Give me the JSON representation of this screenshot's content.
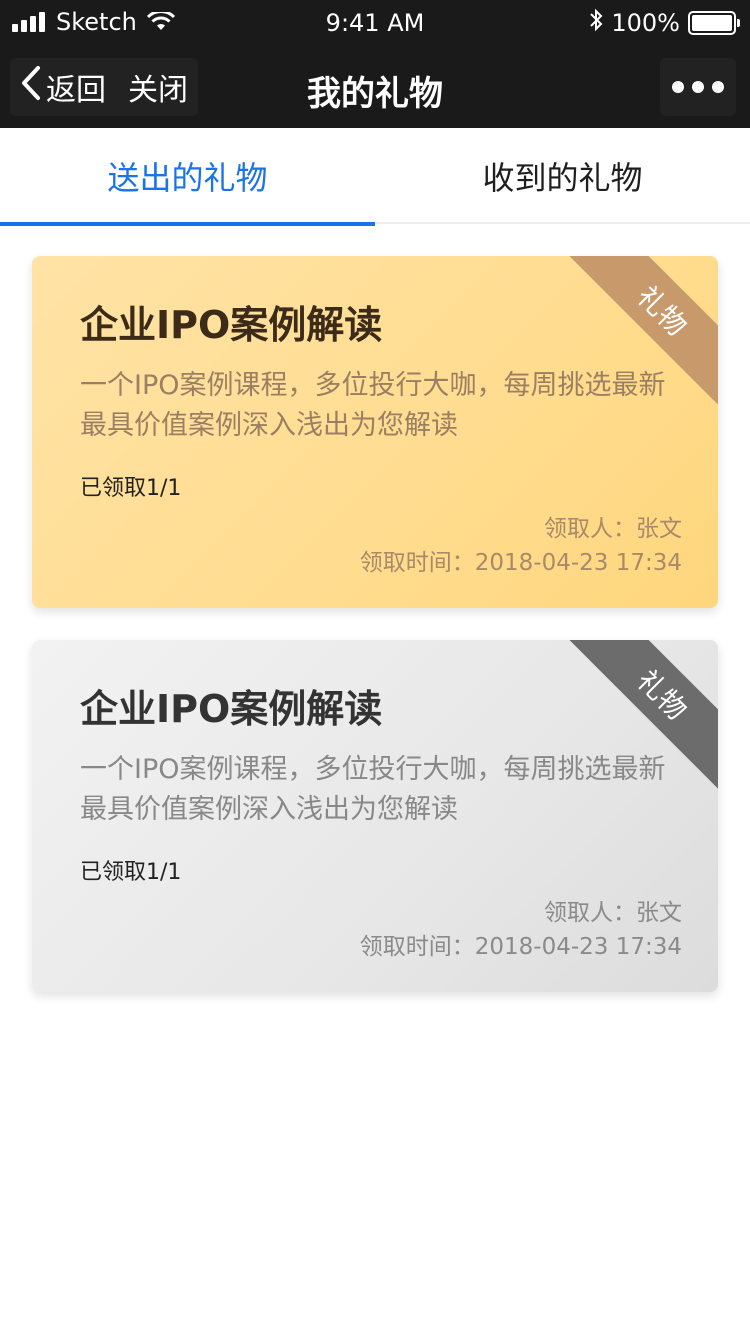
{
  "status_bar": {
    "carrier": "Sketch",
    "time": "9:41 AM",
    "battery": "100%"
  },
  "nav": {
    "back_label": "返回",
    "close_label": "关闭",
    "title": "我的礼物"
  },
  "tabs": [
    {
      "label": "送出的礼物",
      "active": true
    },
    {
      "label": "收到的礼物",
      "active": false
    }
  ],
  "cards": [
    {
      "ribbon": "礼物",
      "title": "企业IPO案例解读",
      "description": "一个IPO案例课程，多位投行大咖，每周挑选最新最具价值案例深入浅出为您解读",
      "claimed": "已领取1/1",
      "receiver": "领取人：张文",
      "received_time": "领取时间：2018-04-23 17:34",
      "theme": "gold"
    },
    {
      "ribbon": "礼物",
      "title": "企业IPO案例解读",
      "description": "一个IPO案例课程，多位投行大咖，每周挑选最新最具价值案例深入浅出为您解读",
      "claimed": "已领取1/1",
      "receiver": "领取人：张文",
      "received_time": "领取时间：2018-04-23 17:34",
      "theme": "grey"
    }
  ],
  "colors": {
    "accent": "#1a73e8",
    "nav_background": "#1a1a1a",
    "gold_card": "#ffdc8f",
    "gold_ribbon": "#c8996a",
    "grey_card": "#e7e7e7",
    "grey_ribbon": "#6c6c6c"
  },
  "icons": [
    "signal-icon",
    "wifi-icon",
    "bluetooth-icon",
    "battery-icon",
    "back-chevron-icon",
    "more-icon"
  ]
}
